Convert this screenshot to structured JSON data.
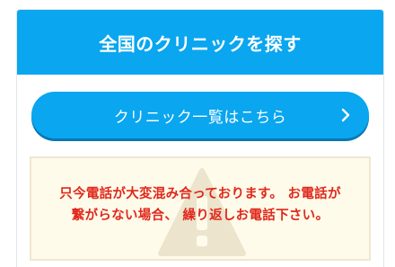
{
  "card": {
    "title": "全国のクリニックを探す"
  },
  "cta": {
    "label": "クリニック一覧はこちら",
    "icon": "chevron-right-icon"
  },
  "notice": {
    "line1": "只今電話が大変混み合っております。 お電話が",
    "line2": "繋がらない場合、 繰り返しお電話下さい。",
    "watermark_icon": "warning-icon"
  },
  "colors": {
    "accent": "#0aa6ef",
    "accent_shadow": "#0878b3",
    "notice_bg": "#fffbea",
    "notice_text": "#e0281c"
  }
}
